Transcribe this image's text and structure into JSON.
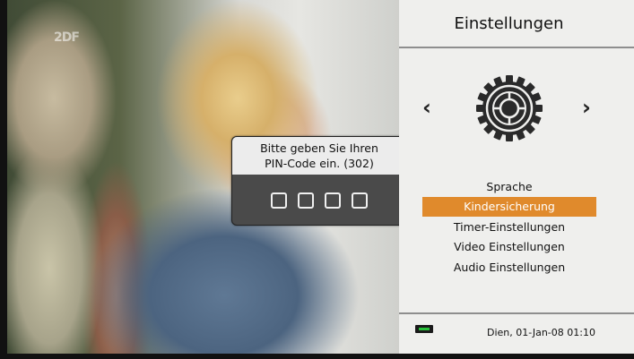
{
  "video": {
    "channel_logo": "2DF"
  },
  "pin_dialog": {
    "line1": "Bitte geben Sie Ihren",
    "line2": "PIN-Code ein. (302)",
    "digits": 4
  },
  "settings_panel": {
    "title": "Einstellungen",
    "icon": "gear-icon",
    "prev_arrow": "‹",
    "next_arrow": "›",
    "menu": [
      {
        "label": "Sprache",
        "selected": false
      },
      {
        "label": "Kindersicherung",
        "selected": true
      },
      {
        "label": "Timer-Einstellungen",
        "selected": false
      },
      {
        "label": "Video Einstellungen",
        "selected": false
      },
      {
        "label": "Audio Einstellungen",
        "selected": false
      }
    ],
    "footer": {
      "status_icon": "usb-icon",
      "datetime": "Dien, 01-Jan-08  01:10"
    }
  },
  "colors": {
    "accent": "#e08a2c",
    "panel_bg": "#efefed",
    "dialog_bg": "#4a4a4a"
  }
}
